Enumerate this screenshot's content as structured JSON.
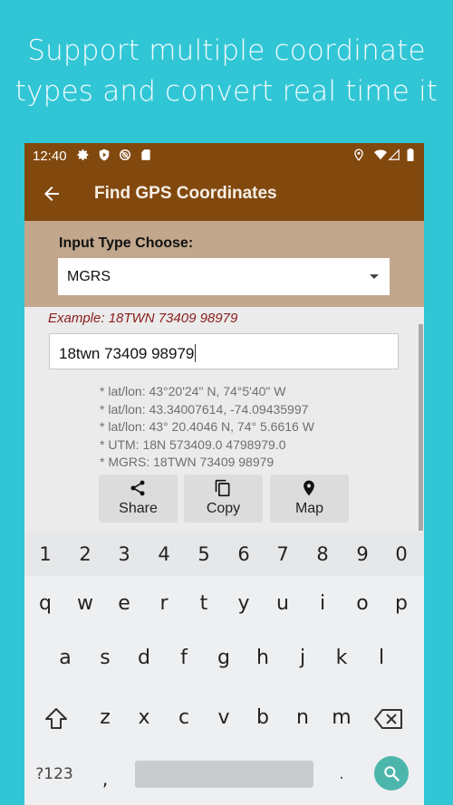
{
  "headline": {
    "line1": "Support multiple coordinate",
    "line2": "types and convert real time it"
  },
  "status_bar": {
    "time": "12:40",
    "left_icons": [
      "gear-icon",
      "shield-play-icon",
      "no-sync-icon",
      "sd-card-icon"
    ],
    "right_icons": [
      "location-icon",
      "wifi-icon",
      "signal-icon",
      "battery-icon"
    ]
  },
  "app_bar": {
    "back_icon": "arrow-back-icon",
    "title": "Find GPS Coordinates"
  },
  "input_type": {
    "label": "Input Type Choose:",
    "selected": "MGRS"
  },
  "example": "Example:  18TWN  73409  98979",
  "coordinate_input": {
    "value": "18twn 73409 98979"
  },
  "results": [
    "* lat/lon: 43°20'24\" N,   74°5'40\" W",
    "* lat/lon: 43.34007614,   -74.09435997",
    "* lat/lon: 43° 20.4046 N,  74° 5.6616 W",
    "* UTM: 18N  573409.0  4798979.0",
    "* MGRS: 18TWN  73409  98979"
  ],
  "actions": [
    {
      "label": "Share",
      "icon": "share-icon"
    },
    {
      "label": "Copy",
      "icon": "copy-icon"
    },
    {
      "label": "Map",
      "icon": "map-pin-icon"
    }
  ],
  "keyboard": {
    "number_row": [
      "1",
      "2",
      "3",
      "4",
      "5",
      "6",
      "7",
      "8",
      "9",
      "0"
    ],
    "row1": [
      "q",
      "w",
      "e",
      "r",
      "t",
      "y",
      "u",
      "i",
      "o",
      "p"
    ],
    "row2": [
      "a",
      "s",
      "d",
      "f",
      "g",
      "h",
      "j",
      "k",
      "l"
    ],
    "row3": [
      "z",
      "x",
      "c",
      "v",
      "b",
      "n",
      "m"
    ],
    "symbols_key": "?123",
    "comma_key": ",",
    "period_key": ".",
    "accent_color": "#4db6ac"
  },
  "colors": {
    "background": "#31c6d6",
    "app_bar": "#82490f",
    "panel": "#c2a78d",
    "example_text": "#8b1c1c"
  }
}
